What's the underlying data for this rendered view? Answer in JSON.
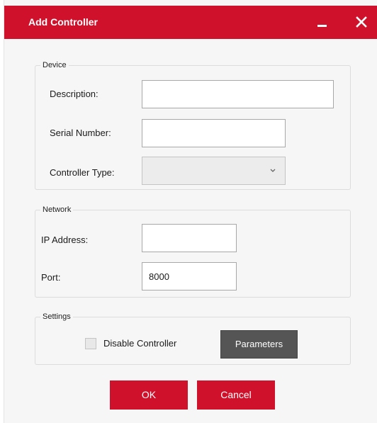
{
  "window": {
    "title": "Add Controller"
  },
  "device": {
    "legend": "Device",
    "description_label": "Description:",
    "description_value": "",
    "serial_label": "Serial Number:",
    "serial_value": "",
    "type_label": "Controller Type:",
    "type_value": ""
  },
  "network": {
    "legend": "Network",
    "ip_label": "IP Address:",
    "ip_value": "",
    "port_label": "Port:",
    "port_value": "8000"
  },
  "settings": {
    "legend": "Settings",
    "disable_label": "Disable Controller",
    "disable_checked": false,
    "parameters_label": "Parameters"
  },
  "actions": {
    "ok_label": "OK",
    "cancel_label": "Cancel"
  },
  "colors": {
    "accent": "#d0112b",
    "dark_button": "#555555",
    "background": "#f6f6f6"
  },
  "icons": {
    "minimize": "minimize-icon",
    "close": "close-icon",
    "dropdown": "chevron-down-icon"
  }
}
